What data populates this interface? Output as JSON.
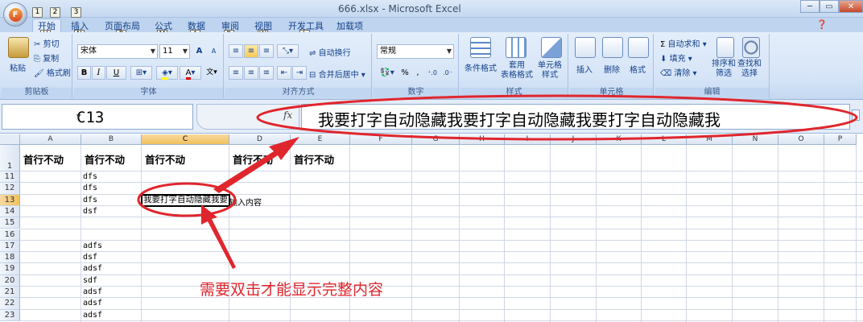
{
  "app": {
    "title": "666.xlsx - Microsoft Excel",
    "office_logo": "F",
    "qat_keytips": [
      "1",
      "2",
      "3"
    ],
    "background_tabs": [
      "...",
      "..."
    ]
  },
  "ribbon_tabs": [
    {
      "label": "开始",
      "keytip": "H",
      "active": true
    },
    {
      "label": "插入",
      "keytip": "N"
    },
    {
      "label": "页面布局",
      "keytip": "P"
    },
    {
      "label": "公式",
      "keytip": "M"
    },
    {
      "label": "数据",
      "keytip": "A"
    },
    {
      "label": "审阅",
      "keytip": "R"
    },
    {
      "label": "视图",
      "keytip": "W"
    },
    {
      "label": "开发工具",
      "keytip": "L"
    },
    {
      "label": "加载项",
      "keytip": ""
    }
  ],
  "ribbon": {
    "clipboard": {
      "label": "剪贴板",
      "paste": "粘贴",
      "cut": "剪切",
      "copy": "复制",
      "format_painter": "格式刷"
    },
    "font": {
      "label": "字体",
      "font_name": "宋体",
      "font_size": "11",
      "bold": "B",
      "italic": "I",
      "underline": "U",
      "grow": "A",
      "shrink": "A"
    },
    "alignment": {
      "label": "对齐方式",
      "wrap": "自动换行",
      "merge": "合并后居中"
    },
    "number": {
      "label": "数字",
      "format": "常规",
      "percent": "%",
      "comma": ","
    },
    "styles": {
      "label": "样式",
      "conditional": "条件格式",
      "table": "套用\n表格格式",
      "cell_style": "单元格\n样式"
    },
    "cells": {
      "label": "单元格",
      "insert": "插入",
      "delete": "删除",
      "format": "格式"
    },
    "editing": {
      "label": "编辑",
      "autosum": "自动求和",
      "fill": "填充",
      "clear": "清除",
      "sort": "排序和\n筛选",
      "find": "查找和\n选择"
    }
  },
  "formula_bar": {
    "name_box": "C13",
    "fx": "fx",
    "content": "我要打字自动隐藏我要打字自动隐藏我要打字自动隐藏我"
  },
  "sheet": {
    "columns": [
      "A",
      "B",
      "C",
      "D",
      "E",
      "F",
      "G",
      "H",
      "I",
      "J",
      "K",
      "L",
      "M",
      "N",
      "O",
      "P"
    ],
    "selected_column": "C",
    "rows": [
      {
        "num": "1",
        "cells": {
          "A": "首行不动",
          "B": "首行不动",
          "C": "首行不动",
          "D": "首行不动",
          "E": "首行不动"
        }
      },
      {
        "num": "11",
        "cells": {
          "B": "dfs"
        }
      },
      {
        "num": "12",
        "cells": {
          "B": "dfs"
        }
      },
      {
        "num": "13",
        "cells": {
          "B": "dfs",
          "C": "我要打字自动隐藏我要",
          "D": "输入内容"
        }
      },
      {
        "num": "14",
        "cells": {
          "B": "dsf"
        }
      },
      {
        "num": "15",
        "cells": {}
      },
      {
        "num": "16",
        "cells": {}
      },
      {
        "num": "17",
        "cells": {
          "B": "adfs"
        }
      },
      {
        "num": "18",
        "cells": {
          "B": "dsf"
        }
      },
      {
        "num": "19",
        "cells": {
          "B": "adsf"
        }
      },
      {
        "num": "20",
        "cells": {
          "B": "sdf"
        }
      },
      {
        "num": "21",
        "cells": {
          "B": "adsf"
        }
      },
      {
        "num": "22",
        "cells": {
          "B": "adsf"
        }
      },
      {
        "num": "23",
        "cells": {
          "B": "adsf"
        }
      }
    ],
    "selected_row": "13"
  },
  "annotation": {
    "text": "需要双击才能显示完整内容",
    "color": "#e0262d"
  }
}
